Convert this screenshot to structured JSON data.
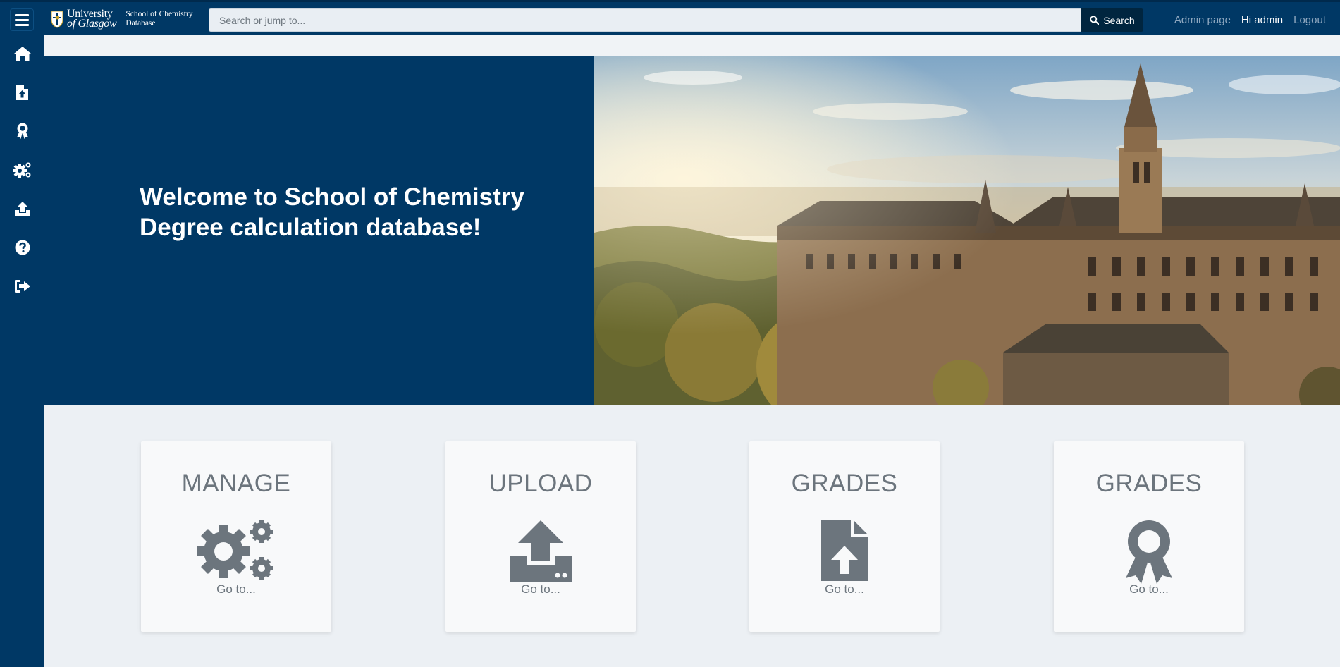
{
  "app": {
    "logo_university_line1": "University",
    "logo_university_line2": "of Glasgow",
    "logo_school_line1": "School of Chemistry",
    "logo_school_line2": "Database"
  },
  "search": {
    "placeholder": "Search or jump to...",
    "button_label": "Search"
  },
  "top_links": {
    "admin_page": "Admin page",
    "greeting": "Hi admin",
    "logout": "Logout"
  },
  "sidebar": {
    "items": [
      {
        "icon": "home-icon"
      },
      {
        "icon": "file-upload-icon"
      },
      {
        "icon": "award-icon"
      },
      {
        "icon": "cogs-icon"
      },
      {
        "icon": "upload-icon"
      },
      {
        "icon": "question-circle-icon"
      },
      {
        "icon": "sign-out-icon"
      }
    ]
  },
  "hero": {
    "title": "Welcome to School of Chemistry Degree calculation database!"
  },
  "cards": [
    {
      "title": "MANAGE",
      "icon": "cogs-icon",
      "link": "Go to..."
    },
    {
      "title": "UPLOAD",
      "icon": "upload-icon",
      "link": "Go to..."
    },
    {
      "title": "GRADES",
      "icon": "file-upload-icon",
      "link": "Go to..."
    },
    {
      "title": "GRADES",
      "icon": "award-icon",
      "link": "Go to..."
    }
  ],
  "colors": {
    "navy": "#003865",
    "card_text": "#6c757d",
    "page_bg": "#ecf0f4"
  }
}
